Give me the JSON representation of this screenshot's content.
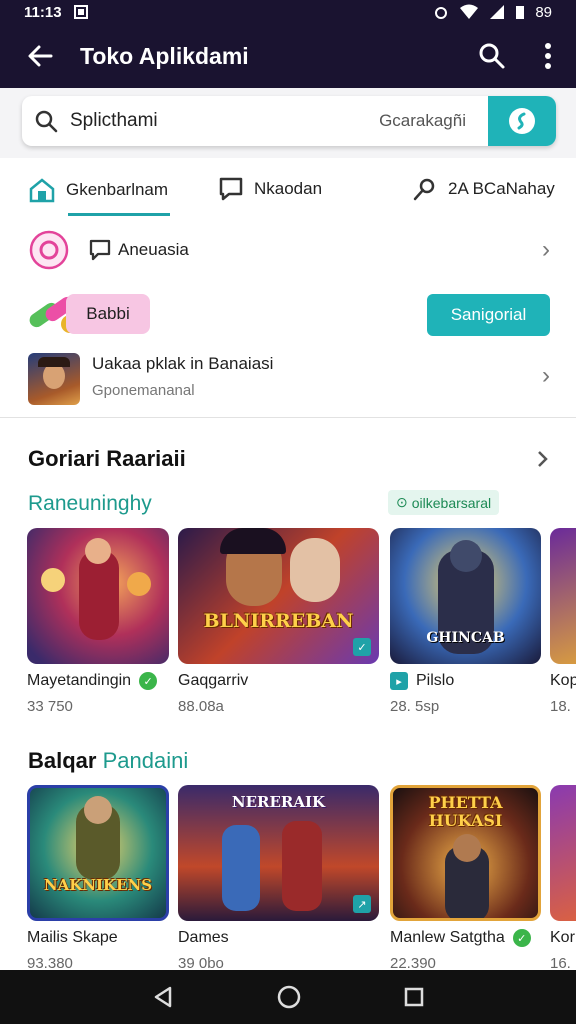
{
  "status": {
    "time": "11:13"
  },
  "appbar": {
    "title": "Toko Aplikdami",
    "back_icon": "arrow-left-icon",
    "search_icon": "search-icon",
    "menu_icon": "more-vert-icon"
  },
  "search": {
    "query": "Splicthami",
    "hint": "Gcarakagñi",
    "button_icon": "voice-icon"
  },
  "tabs": [
    {
      "label": "Gkenbarlnam",
      "icon": "home-icon"
    },
    {
      "label": "Nkaodan",
      "icon": "chat-icon"
    },
    {
      "label": "2A BCaNahay",
      "icon": "pin-icon"
    }
  ],
  "rows": {
    "notif_label": "Aneuasia",
    "promo_chip": "Babbi",
    "promo_button": "Sanigorial",
    "app_title": "Uakaa pklak in Banaiasi",
    "app_sub": "Gponemananal"
  },
  "section1": {
    "title": "Goriari Raariaii",
    "subtitle": "Raneuninghy",
    "badge": "oilkebarsaral",
    "cards": [
      {
        "name": "Mayetandingin",
        "meta": "33 750",
        "mark": "green"
      },
      {
        "name": "Gaqgarriv",
        "meta": "88.08a",
        "mark": "teal",
        "art": "BLNIRREBAN"
      },
      {
        "name": "Pilslo",
        "meta": "28. 5sp",
        "mark": "teal",
        "art": "GHINCAB"
      },
      {
        "name": "Kop",
        "meta": "18.",
        "mark": "none"
      }
    ]
  },
  "section2": {
    "title_dark": "Balqar",
    "title_teal": "Pandaini",
    "cards": [
      {
        "name": "Mailis Skape",
        "meta": "93.380",
        "mark": "none",
        "art": "NAKNIKENS"
      },
      {
        "name": "Dames",
        "meta": "39 0bo",
        "mark": "teal",
        "art": "NERERAIK"
      },
      {
        "name": "Manlew Satgtha",
        "meta": "22.390",
        "mark": "green",
        "art": "PHETTA HUKASI"
      },
      {
        "name": "Kor",
        "meta": "16.",
        "mark": "none"
      }
    ]
  }
}
